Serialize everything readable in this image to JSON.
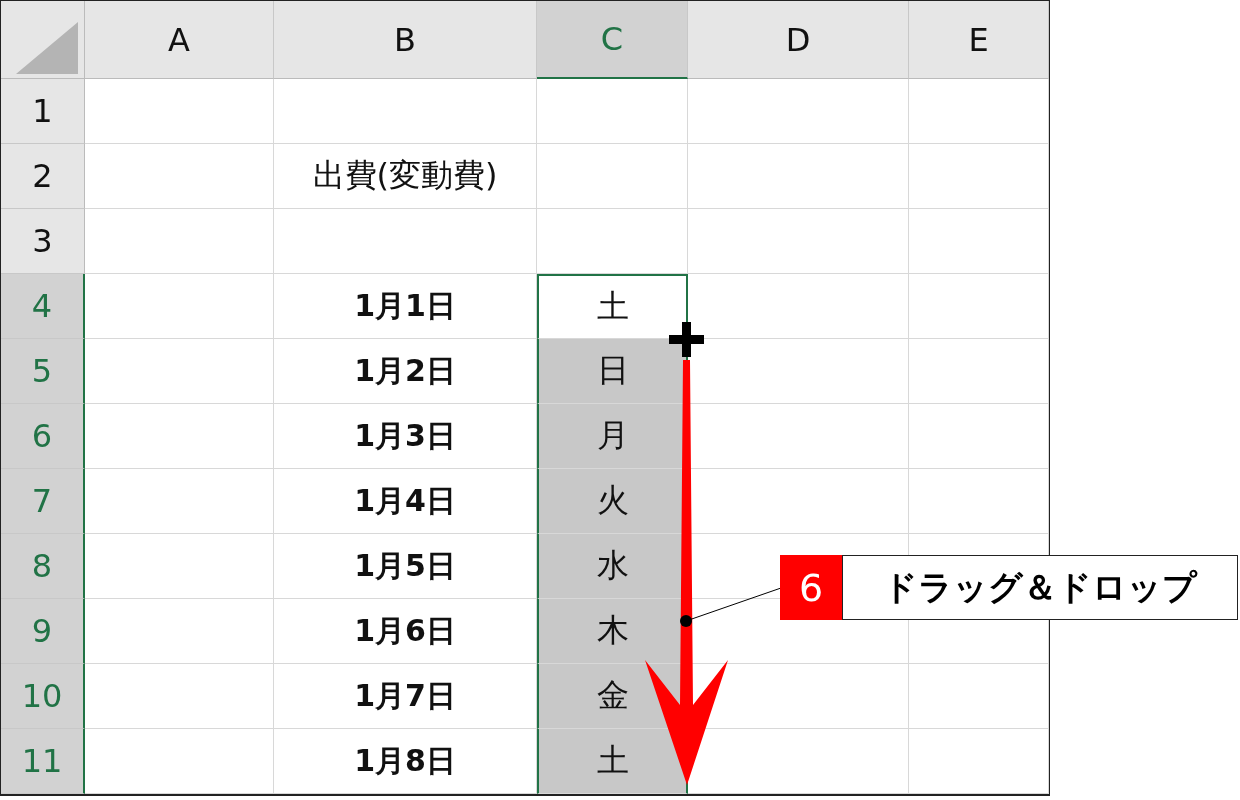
{
  "columns": [
    {
      "label": "A",
      "selected": false
    },
    {
      "label": "B",
      "selected": false
    },
    {
      "label": "C",
      "selected": true
    },
    {
      "label": "D",
      "selected": false
    },
    {
      "label": "E",
      "selected": false
    }
  ],
  "rows": [
    {
      "label": "1",
      "selected": false,
      "cells": {}
    },
    {
      "label": "2",
      "selected": false,
      "cells": {
        "B": {
          "text": "出費(変動費)",
          "bold": false
        }
      }
    },
    {
      "label": "3",
      "selected": false,
      "cells": {}
    },
    {
      "label": "4",
      "selected": true,
      "cells": {
        "B": {
          "text": "1月1日",
          "bold": true
        },
        "C": {
          "text": "土",
          "active": true,
          "filled": false
        }
      }
    },
    {
      "label": "5",
      "selected": true,
      "cells": {
        "B": {
          "text": "1月2日",
          "bold": true
        },
        "C": {
          "text": "日",
          "active": false,
          "filled": true
        }
      }
    },
    {
      "label": "6",
      "selected": true,
      "cells": {
        "B": {
          "text": "1月3日",
          "bold": true
        },
        "C": {
          "text": "月",
          "active": false,
          "filled": true
        }
      }
    },
    {
      "label": "7",
      "selected": true,
      "cells": {
        "B": {
          "text": "1月4日",
          "bold": true
        },
        "C": {
          "text": "火",
          "active": false,
          "filled": true
        }
      }
    },
    {
      "label": "8",
      "selected": true,
      "cells": {
        "B": {
          "text": "1月5日",
          "bold": true
        },
        "C": {
          "text": "水",
          "active": false,
          "filled": true
        }
      }
    },
    {
      "label": "9",
      "selected": true,
      "cells": {
        "B": {
          "text": "1月6日",
          "bold": true
        },
        "C": {
          "text": "木",
          "active": false,
          "filled": true
        }
      }
    },
    {
      "label": "10",
      "selected": true,
      "cells": {
        "B": {
          "text": "1月7日",
          "bold": true
        },
        "C": {
          "text": "金",
          "active": false,
          "filled": true
        }
      }
    },
    {
      "label": "11",
      "selected": true,
      "cells": {
        "B": {
          "text": "1月8日",
          "bold": true
        },
        "C": {
          "text": "土",
          "active": false,
          "filled": true
        }
      }
    }
  ],
  "callout": {
    "number": "6",
    "text": "ドラッグ＆ドロップ"
  }
}
